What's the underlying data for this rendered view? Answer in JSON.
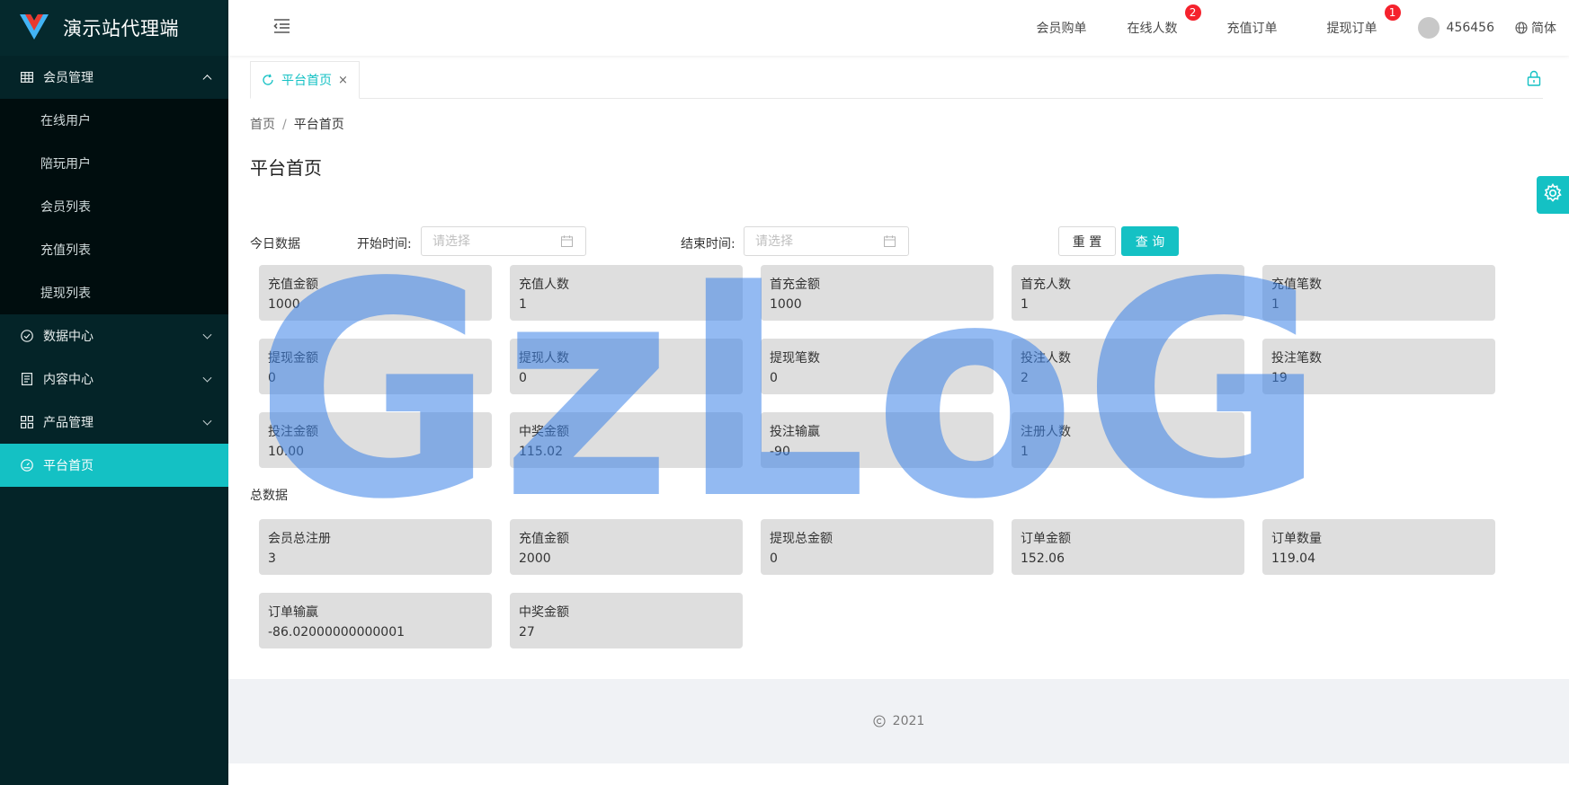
{
  "app": {
    "title": "演示站代理端"
  },
  "sidebar": {
    "groups": [
      {
        "label": "会员管理",
        "icon": "table-icon",
        "expanded": true,
        "items": [
          {
            "label": "在线用户"
          },
          {
            "label": "陪玩用户"
          },
          {
            "label": "会员列表"
          },
          {
            "label": "充值列表"
          },
          {
            "label": "提现列表"
          }
        ]
      },
      {
        "label": "数据中心",
        "icon": "check-circle-icon"
      },
      {
        "label": "内容中心",
        "icon": "file-text-icon"
      },
      {
        "label": "产品管理",
        "icon": "appstore-icon"
      },
      {
        "label": "平台首页",
        "icon": "dashboard-icon",
        "active": true
      }
    ]
  },
  "header": {
    "nav": [
      {
        "label": "会员购单"
      },
      {
        "label": "在线人数",
        "badge": "2"
      },
      {
        "label": "充值订单"
      },
      {
        "label": "提现订单",
        "badge": "1"
      }
    ],
    "user_name": "456456",
    "language": "简体"
  },
  "tabs": [
    {
      "label": "平台首页",
      "close": "×"
    }
  ],
  "breadcrumb": {
    "home": "首页",
    "separator": "/",
    "current": "平台首页"
  },
  "page_title": "平台首页",
  "filter": {
    "section_label": "今日数据",
    "start_label": "开始时间:",
    "start_placeholder": "请选择",
    "end_label": "结束时间:",
    "end_placeholder": "请选择",
    "reset_label": "重 置",
    "query_label": "查 询"
  },
  "today_stats": [
    {
      "label": "充值金额",
      "value": "1000"
    },
    {
      "label": "充值人数",
      "value": "1"
    },
    {
      "label": "首充金额",
      "value": "1000"
    },
    {
      "label": "首充人数",
      "value": "1"
    },
    {
      "label": "充值笔数",
      "value": "1"
    },
    {
      "label": "提现金额",
      "value": "0"
    },
    {
      "label": "提现人数",
      "value": "0"
    },
    {
      "label": "提现笔数",
      "value": "0"
    },
    {
      "label": "投注人数",
      "value": "2"
    },
    {
      "label": "投注笔数",
      "value": "19"
    },
    {
      "label": "投注金额",
      "value": "10.00"
    },
    {
      "label": "中奖金额",
      "value": "115.02"
    },
    {
      "label": "投注输赢",
      "value": "-90"
    },
    {
      "label": "注册人数",
      "value": "1"
    }
  ],
  "total_section_label": "总数据",
  "total_stats": [
    {
      "label": "会员总注册",
      "value": "3"
    },
    {
      "label": "充值金额",
      "value": "2000"
    },
    {
      "label": "提现总金额",
      "value": "0"
    },
    {
      "label": "订单金额",
      "value": "152.06"
    },
    {
      "label": "订单数量",
      "value": "119.04"
    },
    {
      "label": "订单输赢",
      "value": "-86.02000000000001"
    },
    {
      "label": "中奖金额",
      "value": "27"
    }
  ],
  "footer": {
    "text": "2021"
  },
  "watermark": {
    "text": "GzLoG"
  },
  "colors": {
    "accent": "#14c1c4",
    "sidebar": "#042428",
    "badge": "#f5222d",
    "card": "#dedede"
  }
}
